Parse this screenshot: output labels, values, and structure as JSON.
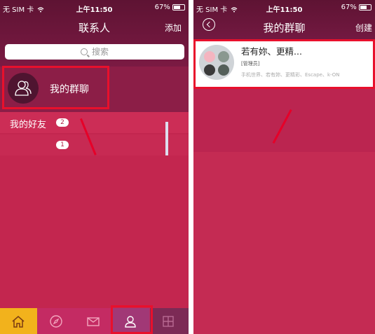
{
  "status_bar": {
    "carrier": "无 SIM 卡",
    "time": "上午11:50",
    "battery": "67%",
    "battery_level": 0.67
  },
  "left": {
    "nav": {
      "title": "联系人",
      "action": "添加"
    },
    "search": {
      "placeholder": "搜索"
    },
    "group_row": {
      "label": "我的群聊"
    },
    "friend_groups": [
      {
        "label": "我的好友",
        "count": "2"
      },
      {
        "label": "",
        "count": "1"
      }
    ],
    "tabbar": {
      "tabs": [
        "home",
        "discover",
        "mail",
        "contacts",
        "other"
      ],
      "selected": "contacts"
    }
  },
  "right": {
    "nav": {
      "title": "我的群聊",
      "action": "创建"
    },
    "group_chat": {
      "title": "若有妳、更精...",
      "tag": "[管理员]",
      "members": "手机世界、若有妳、更精彩、Escape、k-ON"
    }
  },
  "colors": {
    "accent_red": "#e8102c",
    "primary": "#c3264f",
    "nav_dark": "#5e1333",
    "home_tab": "#f2b21c"
  },
  "icons": [
    "wifi-icon",
    "search-icon",
    "contacts-icon",
    "home-icon",
    "compass-icon",
    "mail-icon",
    "person-icon",
    "back-icon"
  ]
}
